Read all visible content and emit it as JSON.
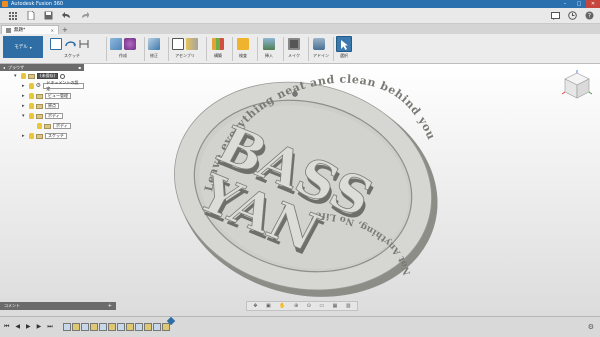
{
  "window": {
    "title": "Autodesk Fusion 360",
    "minimize": "–",
    "maximize": "□",
    "close": "✕"
  },
  "qat": {
    "right_icons": [
      "chat-icon",
      "clock-icon",
      "help-icon"
    ],
    "help_glyph": "?"
  },
  "tabs": [
    {
      "label": "無題*"
    }
  ],
  "ribbon": {
    "workspace": "モデル",
    "groups": [
      {
        "label": "スケッチ"
      },
      {
        "label": "作成"
      },
      {
        "label": "修正"
      },
      {
        "label": "アセンブリ"
      },
      {
        "label": "構築"
      },
      {
        "label": "検査"
      },
      {
        "label": "挿入"
      },
      {
        "label": "メイク"
      },
      {
        "label": "アドイン"
      },
      {
        "label": "選択"
      }
    ]
  },
  "browser": {
    "title": "ブラウザ",
    "items": [
      {
        "label": "(未保存)",
        "indent": 0,
        "expand": "▾"
      },
      {
        "label": "ドキュメントの設定",
        "indent": 1,
        "expand": "▸"
      },
      {
        "label": "ビュー管理",
        "indent": 1,
        "expand": "▸"
      },
      {
        "label": "原点",
        "indent": 1,
        "expand": "▸"
      },
      {
        "label": "ボディ",
        "indent": 1,
        "expand": "▾"
      },
      {
        "label": "ボディ",
        "indent": 2,
        "expand": ""
      },
      {
        "label": "スケッチ",
        "indent": 1,
        "expand": "▸"
      }
    ]
  },
  "comments": {
    "title": "コメント"
  },
  "model": {
    "top_text": "Leave everything neat and clean behind you",
    "bottom_text": "Not Anything, No Life",
    "line1": "BASS",
    "line2": "YAN",
    "colors": {
      "face": "#cfcfcc",
      "edge": "#8d8d88",
      "shadow": "#6e6e6a"
    }
  },
  "timeline": {
    "items": 12
  }
}
